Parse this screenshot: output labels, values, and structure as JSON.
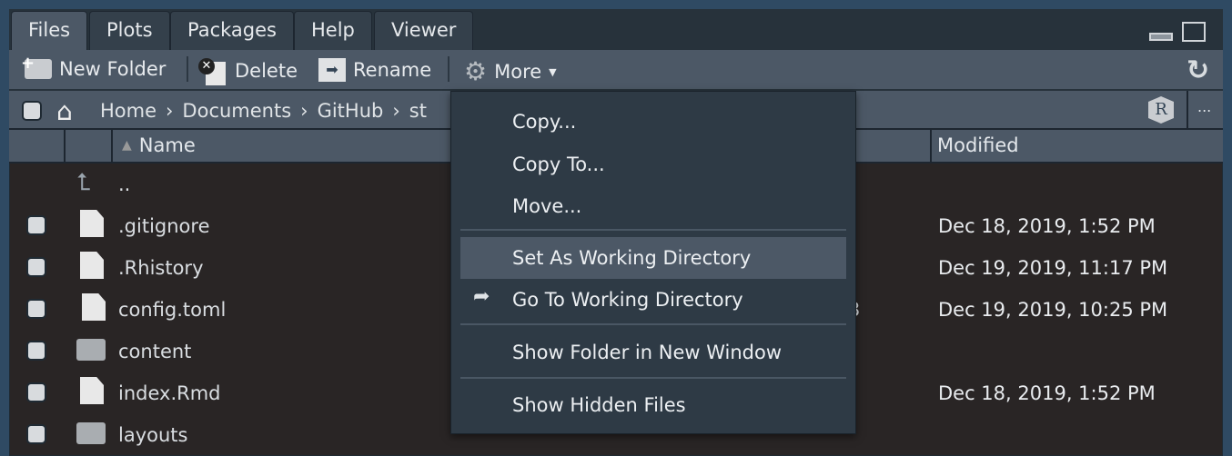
{
  "tabs": [
    {
      "label": "Files",
      "active": true
    },
    {
      "label": "Plots"
    },
    {
      "label": "Packages"
    },
    {
      "label": "Help"
    },
    {
      "label": "Viewer"
    }
  ],
  "toolbar": {
    "new_folder": "New Folder",
    "delete": "Delete",
    "rename": "Rename",
    "more": "More"
  },
  "breadcrumb": [
    "Home",
    "Documents",
    "GitHub",
    "st"
  ],
  "breadcrumb_more": "...",
  "columns": {
    "name": "Name",
    "modified": "Modified"
  },
  "rows": [
    {
      "name": "..",
      "icon": "parent-dir-icon",
      "modified": ""
    },
    {
      "name": ".gitignore",
      "icon": "git-file-icon",
      "modified": "Dec 18, 2019, 1:52 PM"
    },
    {
      "name": ".Rhistory",
      "icon": "history-file-icon",
      "modified": "Dec 19, 2019, 11:17 PM"
    },
    {
      "name": "config.toml",
      "icon": "toml-file-icon",
      "size": "3",
      "modified": "Dec 19, 2019, 10:25 PM"
    },
    {
      "name": "content",
      "icon": "folder-icon",
      "modified": ""
    },
    {
      "name": "index.Rmd",
      "icon": "rmd-file-icon",
      "modified": "Dec 18, 2019, 1:52 PM"
    },
    {
      "name": "layouts",
      "icon": "folder-icon",
      "modified": ""
    }
  ],
  "menu": {
    "copy": "Copy...",
    "copy_to": "Copy To...",
    "move": "Move...",
    "set_wd": "Set As Working Directory",
    "go_wd": "Go To Working Directory",
    "show_folder": "Show Folder in New Window",
    "show_hidden": "Show Hidden Files"
  },
  "colors": {
    "pane_bg": "#292525",
    "toolbar": "#4c5866",
    "menu_bg": "#2e3a45",
    "highlight": "#4c5866"
  }
}
